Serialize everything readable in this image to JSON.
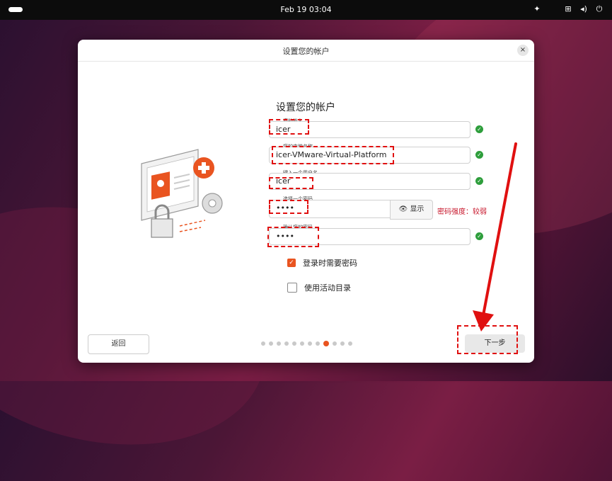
{
  "topbar": {
    "clock": "Feb 19  03:04",
    "tray_icons": [
      "accessibility-icon",
      "network-icon",
      "volume-icon",
      "power-icon"
    ]
  },
  "window": {
    "title": "设置您的帐户",
    "close_label": "×"
  },
  "form": {
    "heading": "设置您的帐户",
    "name": {
      "label": "您的姓名",
      "value": "icer"
    },
    "computer_name": {
      "label": "您的电脑名称",
      "value": "icer-VMware-Virtual-Platform"
    },
    "username": {
      "label": "键入一个用户名",
      "value": "icer"
    },
    "password": {
      "label": "选择一个密码",
      "value": "••••",
      "show_label": "显示",
      "strength": "密码强度：较弱"
    },
    "confirm_password": {
      "label": "确认您的密码",
      "value": "••••"
    },
    "require_password": {
      "label": "登录时需要密码",
      "checked": true
    },
    "active_directory": {
      "label": "使用活动目录",
      "checked": false
    }
  },
  "footer": {
    "back_label": "返回",
    "next_label": "下一步",
    "page_count": 12,
    "current_page": 9
  },
  "colors": {
    "accent": "#e95420",
    "valid": "#2e9e3c",
    "warning": "#c7162b",
    "annotation": "#e01010"
  }
}
